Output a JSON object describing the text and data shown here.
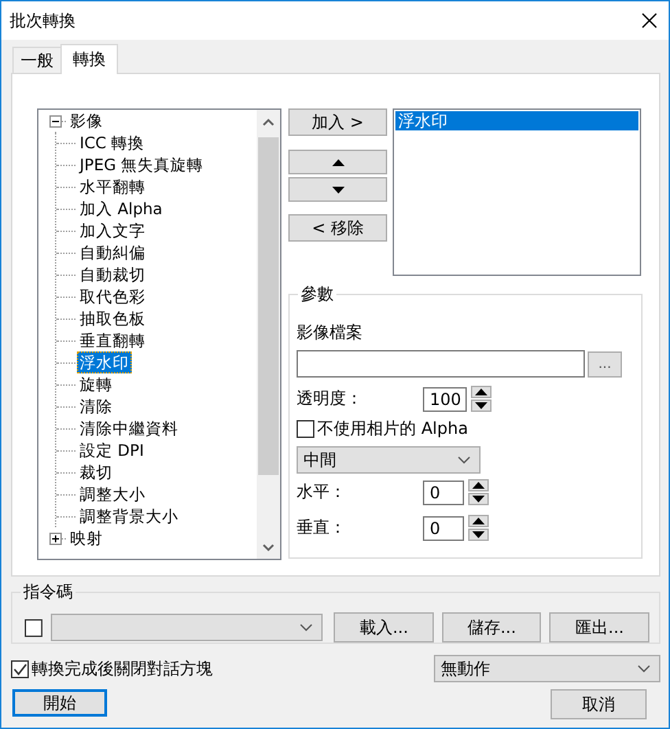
{
  "window": {
    "title": "批次轉換"
  },
  "tabs": [
    {
      "label": "一般",
      "selected": false
    },
    {
      "label": "轉換",
      "selected": true
    }
  ],
  "tree": [
    {
      "label": "影像",
      "expanded": true,
      "selected": false,
      "children": [
        {
          "label": "ICC 轉換",
          "selected": false
        },
        {
          "label": "JPEG 無失真旋轉",
          "selected": false
        },
        {
          "label": "水平翻轉",
          "selected": false
        },
        {
          "label": "加入 Alpha",
          "selected": false
        },
        {
          "label": "加入文字",
          "selected": false
        },
        {
          "label": "自動糾偏",
          "selected": false
        },
        {
          "label": "自動裁切",
          "selected": false
        },
        {
          "label": "取代色彩",
          "selected": false
        },
        {
          "label": "抽取色板",
          "selected": false
        },
        {
          "label": "垂直翻轉",
          "selected": false
        },
        {
          "label": "浮水印",
          "selected": true
        },
        {
          "label": "旋轉",
          "selected": false
        },
        {
          "label": "清除",
          "selected": false
        },
        {
          "label": "清除中繼資料",
          "selected": false
        },
        {
          "label": "設定 DPI",
          "selected": false
        },
        {
          "label": "裁切",
          "selected": false
        },
        {
          "label": "調整大小",
          "selected": false
        },
        {
          "label": "調整背景大小",
          "selected": false
        }
      ]
    },
    {
      "label": "映射",
      "expanded": false,
      "selected": false
    }
  ],
  "add_button": "加入 >",
  "remove_button": "< 移除",
  "applied": [
    {
      "label": "浮水印",
      "selected": true
    }
  ],
  "parameters": {
    "title": "參數",
    "image_file_label": "影像檔案",
    "browse_button": "...",
    "opacity_label": "透明度：",
    "opacity_value": "100",
    "alpha_checkbox": {
      "label": "不使用相片的 Alpha",
      "checked": false
    },
    "position": "中間",
    "horizontal_label": "水平：",
    "horizontal_value": "0",
    "vertical_label": "垂直：",
    "vertical_value": "0"
  },
  "script": {
    "title": "指令碼",
    "checked": false,
    "buttons": [
      "載入...",
      "儲存...",
      "匯出..."
    ]
  },
  "close_after": {
    "label": "轉換完成後關閉對話方塊",
    "checked": true
  },
  "after_action": "無動作",
  "start_button": "開始",
  "cancel_button": "取消"
}
